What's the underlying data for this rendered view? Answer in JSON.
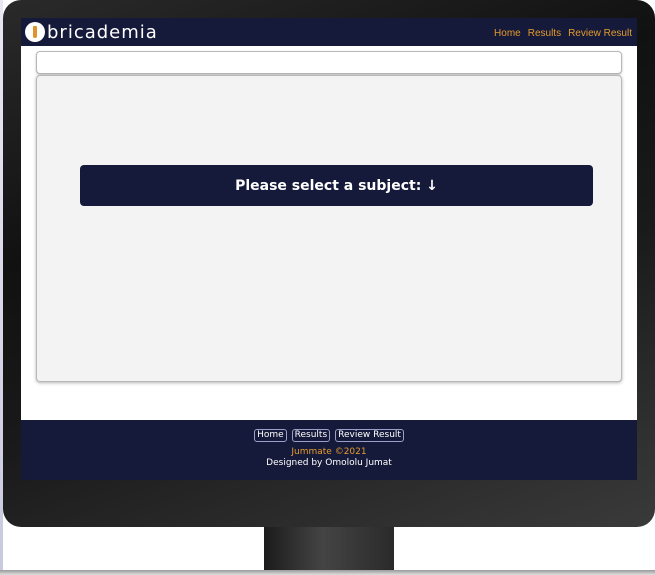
{
  "header": {
    "logo_text": "bricademia",
    "nav": [
      "Home",
      "Results",
      "Review Result"
    ]
  },
  "main": {
    "prompt": "Please select a subject: ↓"
  },
  "footer": {
    "links": [
      "Home",
      "Results",
      "Review Result"
    ],
    "copyright": "Jummate ©2021",
    "credit": "Designed by Omololu Jumat"
  },
  "colors": {
    "navy": "#161a3a",
    "accent": "#e39b2c",
    "panel": "#f3f3f3"
  }
}
